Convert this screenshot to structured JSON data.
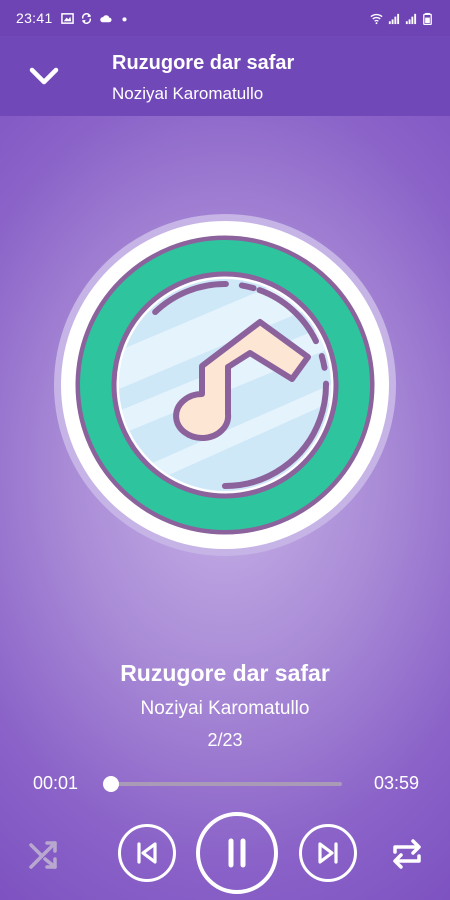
{
  "status_bar": {
    "time": "23:41",
    "left_icons": [
      "image-icon",
      "sync-icon",
      "cloud-icon",
      "dot-icon"
    ],
    "right_icons": [
      "wifi-icon",
      "signal-icon",
      "signal-icon",
      "battery-icon"
    ]
  },
  "header": {
    "title": "Ruzugore dar safar",
    "artist": "Noziyai Karomatullo",
    "collapse_icon": "chevron-down-icon"
  },
  "now_playing": {
    "title": "Ruzugore dar safar",
    "artist": "Noziyai Karomatullo",
    "index": "2/23",
    "artwork_icon": "music-note-icon"
  },
  "progress": {
    "current": "00:01",
    "total": "03:59",
    "position_fraction": 0.004
  },
  "controls": {
    "shuffle_icon": "shuffle-icon",
    "shuffle_active": false,
    "previous_icon": "skip-previous-icon",
    "play_state_icon": "pause-icon",
    "next_icon": "skip-next-icon",
    "repeat_icon": "repeat-icon"
  },
  "colors": {
    "header": "#7148b8",
    "status_bar": "#6e44b4",
    "ring_teal": "#2ec49e",
    "ring_purple": "#8c629d",
    "note_fill": "#fde6d4",
    "disc_blue": "#cfe8f8"
  }
}
